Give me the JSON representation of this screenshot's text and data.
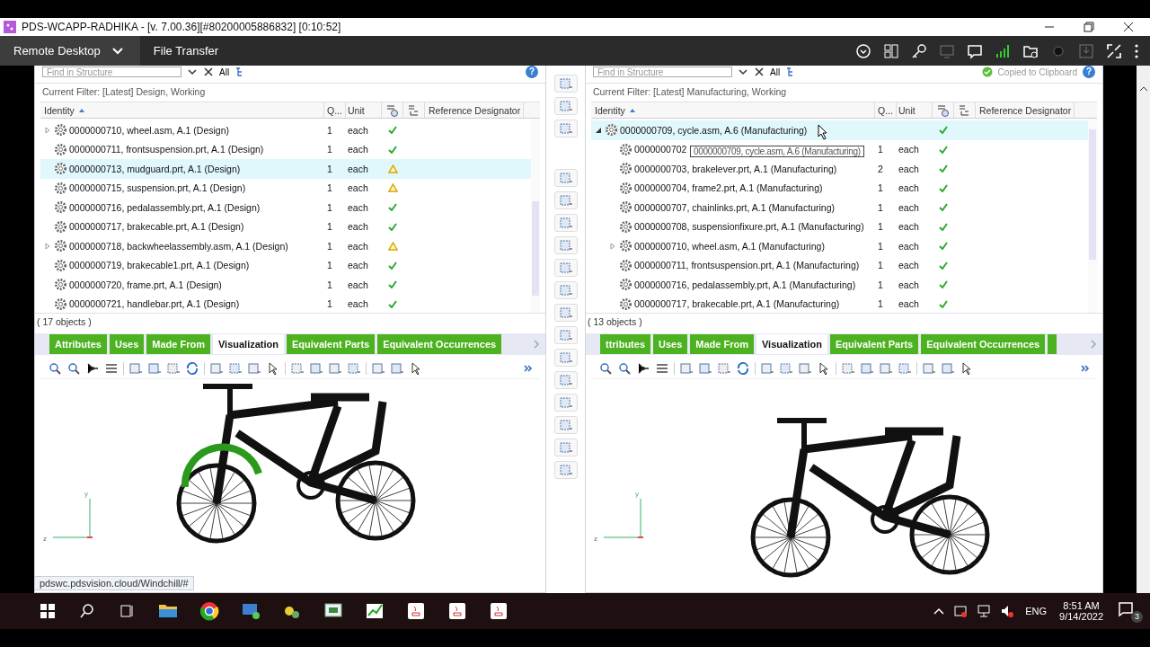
{
  "window": {
    "title": "PDS-WCAPP-RADHIKA -  [v. 7.00.36][#80200005886832] [0:10:52]"
  },
  "remote_toolbar": {
    "tabs": [
      {
        "label": "Remote Desktop",
        "selected": true
      },
      {
        "label": "File Transfer",
        "selected": false
      }
    ]
  },
  "panels": [
    {
      "find_placeholder": "Find in Structure",
      "all_label": "All",
      "help": "?",
      "filter": "Current Filter: [Latest] Design, Working",
      "columns": {
        "identity": "Identity",
        "quantity": "Q...",
        "unit": "Unit",
        "reference": "Reference Designator"
      },
      "rows": [
        {
          "identity": "0000000710, wheel.asm, A.1 (Design)",
          "quantity": "1",
          "unit": "each",
          "warning": false,
          "expandable": true,
          "expanded": false,
          "selected": false
        },
        {
          "identity": "0000000711, frontsuspension.prt, A.1 (Design)",
          "quantity": "1",
          "unit": "each",
          "warning": false,
          "expandable": false,
          "selected": false
        },
        {
          "identity": "0000000713, mudguard.prt, A.1 (Design)",
          "quantity": "1",
          "unit": "each",
          "warning": true,
          "expandable": false,
          "selected": true
        },
        {
          "identity": "0000000715, suspension.prt, A.1 (Design)",
          "quantity": "1",
          "unit": "each",
          "warning": true,
          "expandable": false,
          "selected": false
        },
        {
          "identity": "0000000716, pedalassembly.prt, A.1 (Design)",
          "quantity": "1",
          "unit": "each",
          "warning": false,
          "expandable": false,
          "selected": false
        },
        {
          "identity": "0000000717, brakecable.prt, A.1 (Design)",
          "quantity": "1",
          "unit": "each",
          "warning": false,
          "expandable": false,
          "selected": false
        },
        {
          "identity": "0000000718, backwheelassembly.asm, A.1 (Design)",
          "quantity": "1",
          "unit": "each",
          "warning": true,
          "expandable": true,
          "expanded": false,
          "selected": false
        },
        {
          "identity": "0000000719, brakecable1.prt, A.1 (Design)",
          "quantity": "1",
          "unit": "each",
          "warning": false,
          "expandable": false,
          "selected": false
        },
        {
          "identity": "0000000720, frame.prt, A.1 (Design)",
          "quantity": "1",
          "unit": "each",
          "warning": false,
          "expandable": false,
          "selected": false
        },
        {
          "identity": "0000000721, handlebar.prt, A.1 (Design)",
          "quantity": "1",
          "unit": "each",
          "warning": false,
          "expandable": false,
          "selected": false
        }
      ],
      "count": "( 17 objects )",
      "tabs": [
        {
          "label": "Attributes",
          "selected": false
        },
        {
          "label": "Uses",
          "selected": false
        },
        {
          "label": "Made From",
          "selected": false
        },
        {
          "label": "Visualization",
          "selected": true
        },
        {
          "label": "Equivalent Parts",
          "selected": false
        },
        {
          "label": "Equivalent Occurrences",
          "selected": false
        }
      ],
      "viewer": {
        "highlight_part": true,
        "axis_labels": {
          "vertical": "y",
          "horizontal": "z"
        }
      }
    },
    {
      "find_placeholder": "Find in Structure",
      "all_label": "All",
      "notice": "Copied to Clipboard",
      "help": "?",
      "filter": "Current Filter: [Latest] Manufacturing, Working",
      "columns": {
        "identity": "Identity",
        "quantity": "Q...",
        "unit": "Unit",
        "reference": "Reference Designator"
      },
      "rows": [
        {
          "identity": "0000000709, cycle.asm, A.6 (Manufacturing)",
          "warning": false,
          "expandable": true,
          "expanded": true,
          "selected": true,
          "tooltip": "0000000709, cycle.asm, A.6 (Manufacturing)",
          "children": [
            {
              "identity": "0000000702",
              "quantity": "1",
              "unit": "each",
              "warning": false,
              "expandable": false,
              "selected": false
            },
            {
              "identity": "0000000703, brakelever.prt, A.1 (Manufacturing)",
              "quantity": "2",
              "unit": "each",
              "warning": false,
              "expandable": false,
              "selected": false
            },
            {
              "identity": "0000000704, frame2.prt, A.1 (Manufacturing)",
              "quantity": "1",
              "unit": "each",
              "warning": false,
              "expandable": false,
              "selected": false
            },
            {
              "identity": "0000000707, chainlinks.prt, A.1 (Manufacturing)",
              "quantity": "1",
              "unit": "each",
              "warning": false,
              "expandable": false,
              "selected": false
            },
            {
              "identity": "0000000708, suspensionfixure.prt, A.1 (Manufacturing)",
              "quantity": "1",
              "unit": "each",
              "warning": false,
              "expandable": false,
              "selected": false
            },
            {
              "identity": "0000000710, wheel.asm, A.1 (Manufacturing)",
              "quantity": "1",
              "unit": "each",
              "warning": false,
              "expandable": true,
              "expanded": false,
              "selected": false
            },
            {
              "identity": "0000000711, frontsuspension.prt, A.1 (Manufacturing)",
              "quantity": "1",
              "unit": "each",
              "warning": false,
              "expandable": false,
              "selected": false
            },
            {
              "identity": "0000000716, pedalassembly.prt, A.1 (Manufacturing)",
              "quantity": "1",
              "unit": "each",
              "warning": false,
              "expandable": false,
              "selected": false
            },
            {
              "identity": "0000000717, brakecable.prt, A.1 (Manufacturing)",
              "quantity": "1",
              "unit": "each",
              "warning": false,
              "expandable": false,
              "selected": false
            }
          ]
        }
      ],
      "count": "( 13 objects )",
      "tabs": [
        {
          "label": "ttributes",
          "selected": false
        },
        {
          "label": "Uses",
          "selected": false
        },
        {
          "label": "Made From",
          "selected": false
        },
        {
          "label": "Visualization",
          "selected": true
        },
        {
          "label": "Equivalent Parts",
          "selected": false
        },
        {
          "label": "Equivalent Occurrences",
          "selected": false
        }
      ],
      "overflow_tab": true,
      "viewer": {
        "highlight_part": false,
        "axis_labels": {
          "vertical": "y",
          "horizontal": "z"
        }
      }
    }
  ],
  "status_url": "pdswc.pdsvision.cloud/Windchill/#",
  "taskbar": {
    "language": "ENG",
    "time": "8:51 AM",
    "date": "9/14/2022",
    "notifications": "3"
  }
}
